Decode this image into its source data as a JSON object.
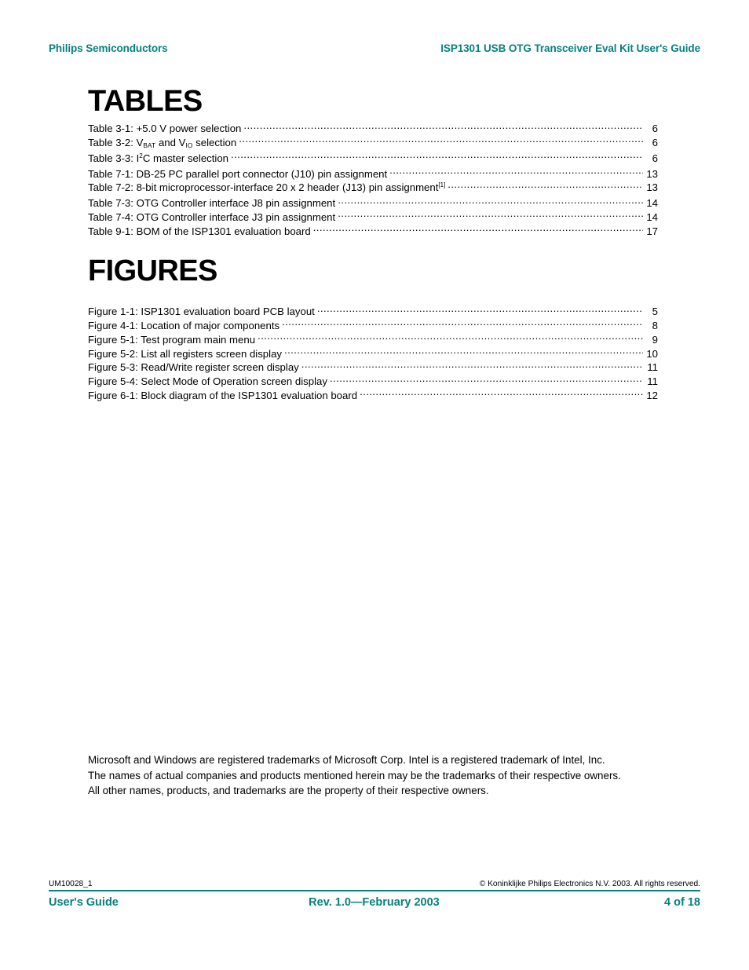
{
  "header": {
    "left": "Philips Semiconductors",
    "right": "ISP1301 USB OTG Transceiver Eval Kit User's Guide",
    "accent_color": "#08817e"
  },
  "tables_section": {
    "title": "TABLES",
    "entries": [
      {
        "label_plain": "Table 3-1: +5.0 V power selection",
        "page": "6"
      },
      {
        "label_plain": "Table 3-2: VBAT and VIO selection",
        "page": "6"
      },
      {
        "label_plain": "Table 3-3: I2C master selection",
        "page": "6"
      },
      {
        "label_plain": "Table 7-1: DB-25 PC parallel port connector (J10) pin assignment",
        "page": "13"
      },
      {
        "label_plain": "Table 7-2: 8-bit microprocessor-interface 20 x 2 header (J13) pin assignment[1]",
        "page": "13"
      },
      {
        "label_plain": "Table 7-3: OTG Controller interface J8 pin assignment",
        "page": "14"
      },
      {
        "label_plain": "Table 7-4: OTG Controller interface J3 pin assignment",
        "page": "14"
      },
      {
        "label_plain": "Table 9-1: BOM of the ISP1301 evaluation board",
        "page": "17"
      }
    ],
    "entry_parts": {
      "t1": "Table 3-1: +5.0 V power selection",
      "t2_a": "Table 3-2: V",
      "t2_sub1": "BAT",
      "t2_b": " and V",
      "t2_sub2": "IO",
      "t2_c": " selection",
      "t3_a": "Table 3-3: I",
      "t3_sup": "2",
      "t3_b": "C master selection",
      "t4": "Table 7-1: DB-25 PC parallel port connector (J10) pin assignment",
      "t5_a": "Table 7-2: 8-bit microprocessor-interface 20 x 2 header (J13) pin assignment",
      "t5_sup": "[1]",
      "t6": "Table 7-3: OTG Controller interface J8 pin assignment",
      "t7": "Table 7-4: OTG Controller interface J3 pin assignment",
      "t8": "Table 9-1: BOM of the ISP1301 evaluation board"
    },
    "pages": {
      "p1": "6",
      "p2": "6",
      "p3": "6",
      "p4": "13",
      "p5": "13",
      "p6": "14",
      "p7": "14",
      "p8": "17"
    }
  },
  "figures_section": {
    "title": "FIGURES",
    "entries": [
      {
        "label": "Figure 1-1: ISP1301 evaluation board PCB layout",
        "page": "5"
      },
      {
        "label": "Figure 4-1: Location of major components",
        "page": "8"
      },
      {
        "label": "Figure 5-1: Test program main menu",
        "page": "9"
      },
      {
        "label": "Figure 5-2: List all registers screen display",
        "page": "10"
      },
      {
        "label": "Figure 5-3: Read/Write register screen display",
        "page": "11"
      },
      {
        "label": "Figure 5-4: Select Mode of Operation screen display",
        "page": "11"
      },
      {
        "label": "Figure 6-1: Block diagram of the ISP1301 evaluation board",
        "page": "12"
      }
    ]
  },
  "trademark": {
    "line1": "Microsoft and Windows are registered trademarks of Microsoft Corp. Intel is a registered trademark of Intel, Inc.",
    "line2": "The names of actual companies and products mentioned herein may be the trademarks of their respective owners.",
    "line3": "All other names, products, and trademarks are the property of their respective owners."
  },
  "footer": {
    "doc_id": "UM10028_1",
    "copyright": "© Koninklijke Philips Electronics N.V. 2003. All rights reserved.",
    "left": "User's Guide",
    "center": "Rev. 1.0—February 2003",
    "right": "4 of 18"
  }
}
